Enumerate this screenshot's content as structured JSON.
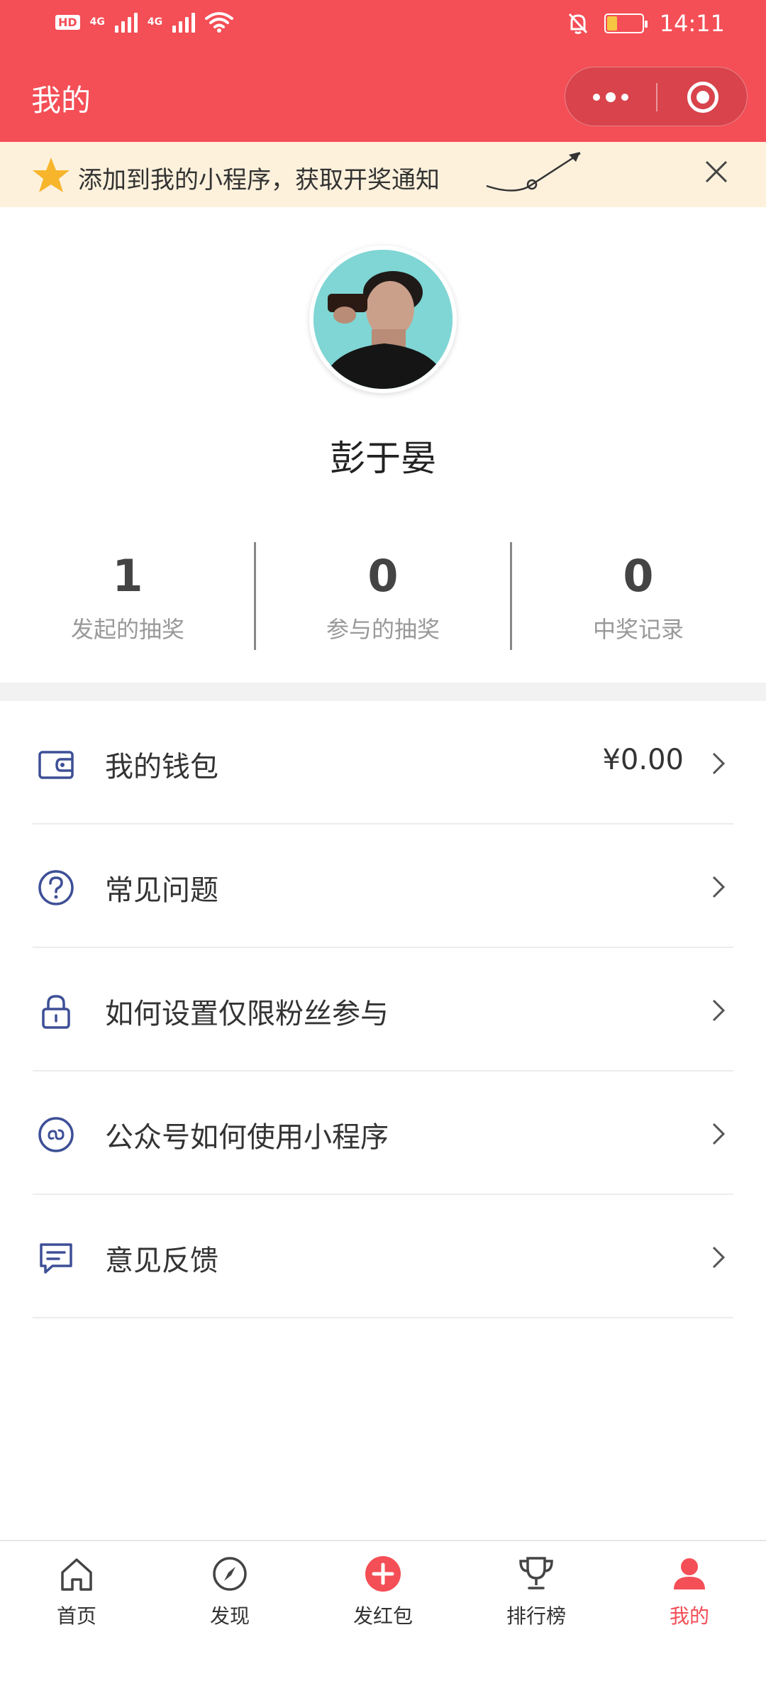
{
  "status_bar": {
    "hd": "HD",
    "net1": "4G",
    "net2": "4G",
    "battery": "16",
    "time": "14:11"
  },
  "header": {
    "title": "我的"
  },
  "notice": {
    "text": "添加到我的小程序，获取开奖通知"
  },
  "profile": {
    "username": "彭于晏"
  },
  "stats": [
    {
      "value": "1",
      "label": "发起的抽奖"
    },
    {
      "value": "0",
      "label": "参与的抽奖"
    },
    {
      "value": "0",
      "label": "中奖记录"
    }
  ],
  "menu": [
    {
      "label": "我的钱包",
      "value": "¥0.00",
      "icon": "wallet-icon"
    },
    {
      "label": "常见问题",
      "value": "",
      "icon": "question-icon"
    },
    {
      "label": "如何设置仅限粉丝参与",
      "value": "",
      "icon": "lock-icon"
    },
    {
      "label": "公众号如何使用小程序",
      "value": "",
      "icon": "mini-program-icon"
    },
    {
      "label": "意见反馈",
      "value": "",
      "icon": "feedback-icon"
    }
  ],
  "tabs": [
    {
      "label": "首页",
      "icon": "home-icon"
    },
    {
      "label": "发现",
      "icon": "compass-icon"
    },
    {
      "label": "发红包",
      "icon": "add-icon"
    },
    {
      "label": "排行榜",
      "icon": "trophy-icon"
    },
    {
      "label": "我的",
      "icon": "user-icon"
    }
  ],
  "colors": {
    "brand_red": "#f44e56",
    "icon_blue": "#3d4f96",
    "notice_bg": "#fdf1dc"
  }
}
